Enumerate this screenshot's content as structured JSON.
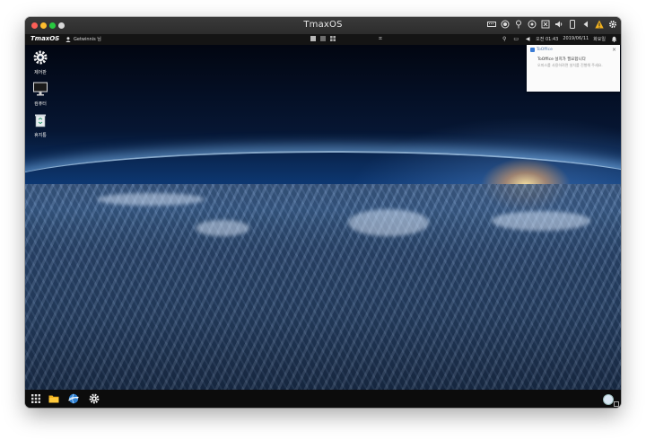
{
  "window": {
    "title": "TmaxOS",
    "title_icons": [
      "keyboard-icon",
      "record-icon",
      "pin-icon",
      "power-icon",
      "network-icon",
      "volume-icon",
      "phone-icon",
      "back-icon",
      "warning-icon",
      "settings-icon"
    ]
  },
  "topbar": {
    "logo": "TmaxOS",
    "user": "Getwinnis 님",
    "views": [
      "tile-view",
      "single-view",
      "grid-view"
    ],
    "clock": "오전 01:43",
    "date": "2019/06/11",
    "day": "화요일"
  },
  "desktop": {
    "icons": [
      {
        "label": "제어판",
        "icon": "gear-icon"
      },
      {
        "label": "컴퓨터",
        "icon": "monitor-icon"
      },
      {
        "label": "휴지통",
        "icon": "trash-icon"
      }
    ]
  },
  "notification": {
    "app": "ToOffice",
    "title": "ToOffice 설치가 필요합니다",
    "body": "오피스를 사용하려면 설치를 진행해 주세요.",
    "close": "×"
  },
  "taskbar": {
    "items": [
      "apps-grid-icon",
      "folder-icon",
      "browser-icon",
      "settings-icon"
    ]
  },
  "colors": {
    "titlebar": "#2f2f2f",
    "topbar": "#141414",
    "taskbar": "#0c0c0c",
    "accent": "#3a7bd5"
  }
}
